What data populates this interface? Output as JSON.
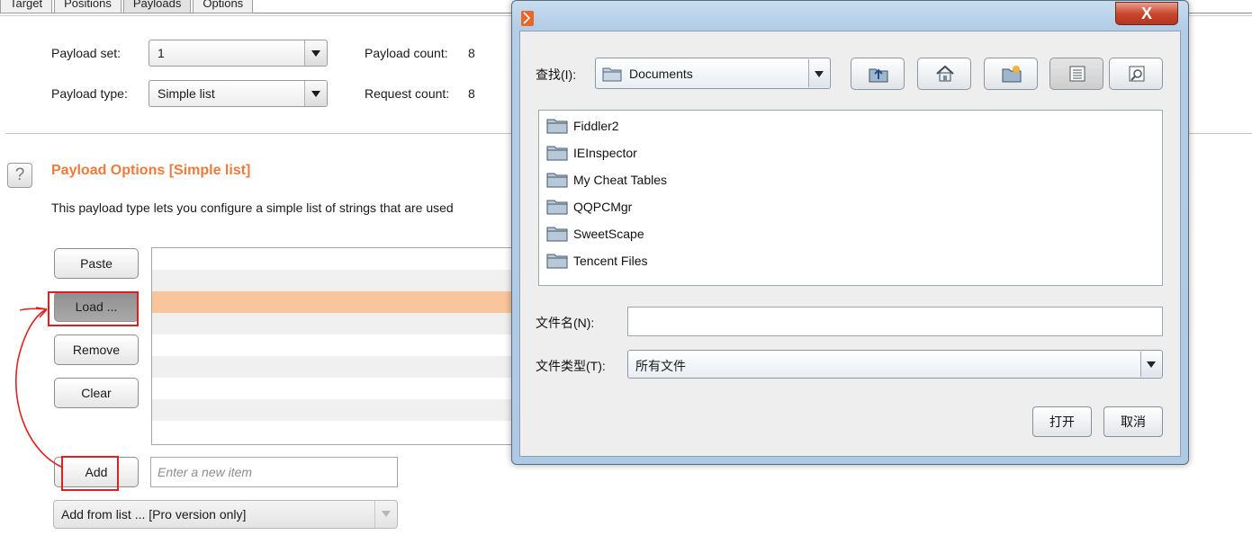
{
  "tabs": [
    "Target",
    "Positions",
    "Payloads",
    "Options"
  ],
  "active_tab": "Payloads",
  "payload_set": {
    "label": "Payload set:",
    "value": "1"
  },
  "payload_type": {
    "label": "Payload type:",
    "value": "Simple list"
  },
  "payload_count": {
    "label": "Payload count:",
    "value": "8"
  },
  "request_count": {
    "label": "Request count:",
    "value": "8"
  },
  "options": {
    "title": "Payload Options [Simple list]",
    "description": "This payload type lets you configure a simple list of strings that are used",
    "help_label": "?"
  },
  "buttons": {
    "paste": "Paste",
    "load": "Load ...",
    "remove": "Remove",
    "clear": "Clear",
    "add": "Add"
  },
  "new_item": {
    "placeholder": "Enter a new item",
    "value": ""
  },
  "add_from_list": "Add from list ... [Pro version only]",
  "dialog": {
    "close_label": "X",
    "lookin_label": "查找(I):",
    "lookin_value": "Documents",
    "toolbar": [
      "up-folder-icon",
      "home-icon",
      "new-folder-icon",
      "list-view-icon",
      "details-view-icon"
    ],
    "folders": [
      "Fiddler2",
      "IEInspector",
      "My Cheat Tables",
      "QQPCMgr",
      "SweetScape",
      "Tencent Files"
    ],
    "filename_label": "文件名(N):",
    "filename_value": "",
    "filetype_label": "文件类型(T):",
    "filetype_value": "所有文件",
    "open_label": "打开",
    "cancel_label": "取消"
  },
  "colors": {
    "accent": "#ee7a3c",
    "selected_row": "#f9c59c",
    "annotation": "#e02020"
  }
}
